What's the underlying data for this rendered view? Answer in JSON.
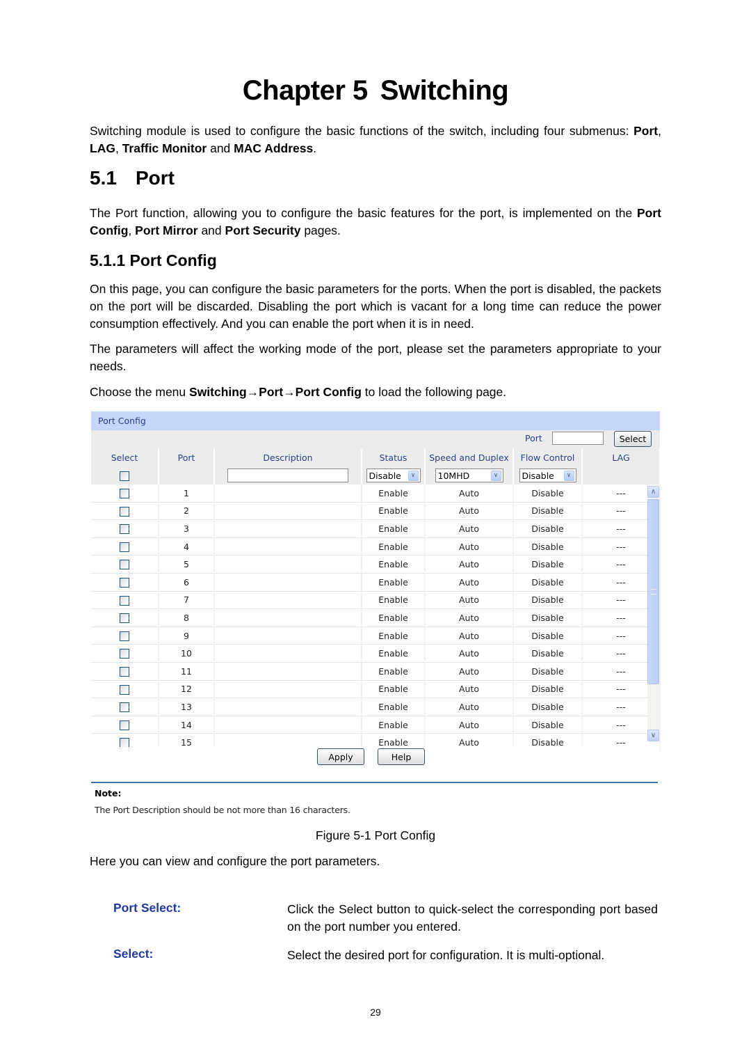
{
  "chapter": {
    "prefix": "Chapter 5",
    "title": "Switching"
  },
  "intro": {
    "text_before": "Switching module is used to configure the basic functions of the switch, including four submenus: ",
    "submenus": [
      "Port",
      "LAG",
      "Traffic Monitor",
      "MAC Address"
    ],
    "sep1": ", ",
    "sep2": ", ",
    "sep3": " and ",
    "end": "."
  },
  "section": {
    "number": "5.1",
    "title": "Port",
    "text_before": "The Port function, allowing you to configure the basic features for the port, is implemented on the ",
    "pages": [
      "Port Config",
      "Port Mirror",
      "Port Security"
    ],
    "sep1": ", ",
    "sep2": " and ",
    "text_after": " pages."
  },
  "subsection": {
    "title": "5.1.1 Port Config",
    "para1": "On this page, you can configure the basic parameters for the ports. When the port is disabled, the packets on the port will be discarded. Disabling the port which is vacant for a long time can reduce the power consumption effectively. And you can enable the port when it is in need.",
    "para2": "The parameters will affect the working mode of the port, please set the parameters appropriate to your needs.",
    "menu_before": "Choose the menu ",
    "menu_path": "Switching→Port→Port Config",
    "menu_after": " to load the following page."
  },
  "panel": {
    "header": "Port Config",
    "port_select": {
      "label": "Port",
      "value": "",
      "button": "Select"
    },
    "columns": [
      "Select",
      "Port",
      "Description",
      "Status",
      "Speed and Duplex",
      "Flow Control",
      "LAG"
    ],
    "controls": {
      "description_value": "",
      "status": "Disable",
      "speed": "10MHD",
      "flow_control": "Disable"
    },
    "rows": [
      {
        "port": "1",
        "description": "",
        "status": "Enable",
        "speed": "Auto",
        "flow": "Disable",
        "lag": "---"
      },
      {
        "port": "2",
        "description": "",
        "status": "Enable",
        "speed": "Auto",
        "flow": "Disable",
        "lag": "---"
      },
      {
        "port": "3",
        "description": "",
        "status": "Enable",
        "speed": "Auto",
        "flow": "Disable",
        "lag": "---"
      },
      {
        "port": "4",
        "description": "",
        "status": "Enable",
        "speed": "Auto",
        "flow": "Disable",
        "lag": "---"
      },
      {
        "port": "5",
        "description": "",
        "status": "Enable",
        "speed": "Auto",
        "flow": "Disable",
        "lag": "---"
      },
      {
        "port": "6",
        "description": "",
        "status": "Enable",
        "speed": "Auto",
        "flow": "Disable",
        "lag": "---"
      },
      {
        "port": "7",
        "description": "",
        "status": "Enable",
        "speed": "Auto",
        "flow": "Disable",
        "lag": "---"
      },
      {
        "port": "8",
        "description": "",
        "status": "Enable",
        "speed": "Auto",
        "flow": "Disable",
        "lag": "---"
      },
      {
        "port": "9",
        "description": "",
        "status": "Enable",
        "speed": "Auto",
        "flow": "Disable",
        "lag": "---"
      },
      {
        "port": "10",
        "description": "",
        "status": "Enable",
        "speed": "Auto",
        "flow": "Disable",
        "lag": "---"
      },
      {
        "port": "11",
        "description": "",
        "status": "Enable",
        "speed": "Auto",
        "flow": "Disable",
        "lag": "---"
      },
      {
        "port": "12",
        "description": "",
        "status": "Enable",
        "speed": "Auto",
        "flow": "Disable",
        "lag": "---"
      },
      {
        "port": "13",
        "description": "",
        "status": "Enable",
        "speed": "Auto",
        "flow": "Disable",
        "lag": "---"
      },
      {
        "port": "14",
        "description": "",
        "status": "Enable",
        "speed": "Auto",
        "flow": "Disable",
        "lag": "---"
      },
      {
        "port": "15",
        "description": "",
        "status": "Enable",
        "speed": "Auto",
        "flow": "Disable",
        "lag": "---"
      }
    ],
    "buttons": {
      "apply": "Apply",
      "help": "Help"
    },
    "note": {
      "title": "Note:",
      "text": "The Port Description should be not more than 16 characters."
    },
    "icons": {
      "dropdown": "chevron-down-icon",
      "scroll_up": "chevron-up-icon",
      "scroll_down": "chevron-down-icon"
    },
    "colors": {
      "header_bg": "#c4d7fa",
      "label_text": "#2a3f86",
      "body_bg": "#ececec",
      "note_line": "#3f6ea8"
    }
  },
  "figure_caption": "Figure 5-1 Port Config",
  "after_figure": "Here you can view and configure the port parameters.",
  "definitions": [
    {
      "term": "Port Select:",
      "desc": "Click the Select button to quick-select the corresponding port based on the port number you entered."
    },
    {
      "term": "Select:",
      "desc": "Select the desired port for configuration. It is multi-optional."
    }
  ],
  "colors": {
    "term": "#1f3aa0"
  },
  "page_number": "29"
}
